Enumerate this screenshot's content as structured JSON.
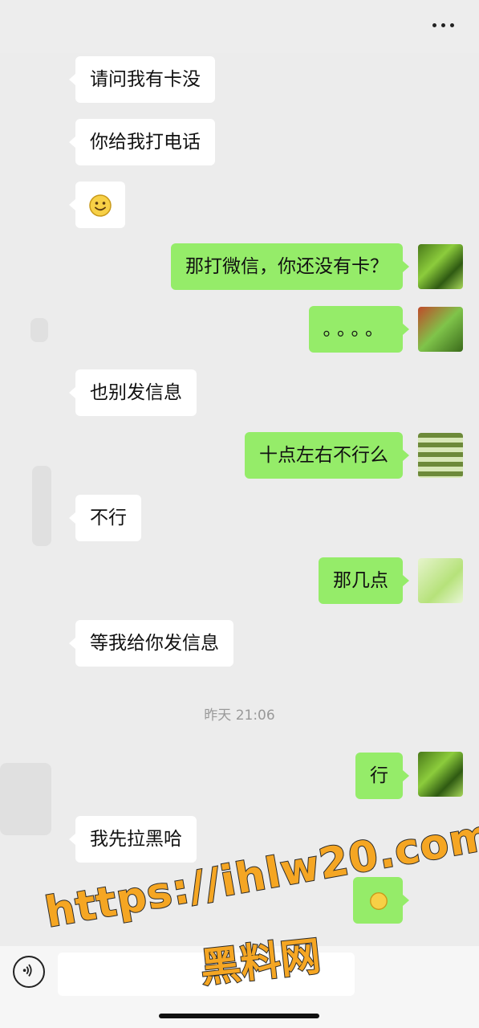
{
  "header": {
    "more_label": "..."
  },
  "messages": [
    {
      "side": "left",
      "text": "请问我有卡没"
    },
    {
      "side": "left",
      "text": "你给我打电话"
    },
    {
      "side": "left",
      "emoji": "smile"
    },
    {
      "side": "right",
      "text": "那打微信，你还没有卡？"
    },
    {
      "side": "right",
      "text": "。。。。"
    },
    {
      "side": "left",
      "text": "也别发信息"
    },
    {
      "side": "right",
      "text": "十点左右不行么"
    },
    {
      "side": "left",
      "text": "不行"
    },
    {
      "side": "right",
      "text": "那几点"
    },
    {
      "side": "left",
      "text": "等我给你发信息"
    },
    {
      "side": "right",
      "text": "行"
    },
    {
      "side": "left",
      "text": "我先拉黑哈"
    },
    {
      "side": "right",
      "emoji": "bye"
    }
  ],
  "timestamp": "昨天 21:06",
  "watermark": {
    "url": "https://ihlw20.com",
    "site": "黑料网"
  },
  "colors": {
    "bubble_right": "#95ec69",
    "bubble_left": "#ffffff",
    "background": "#ececec"
  }
}
